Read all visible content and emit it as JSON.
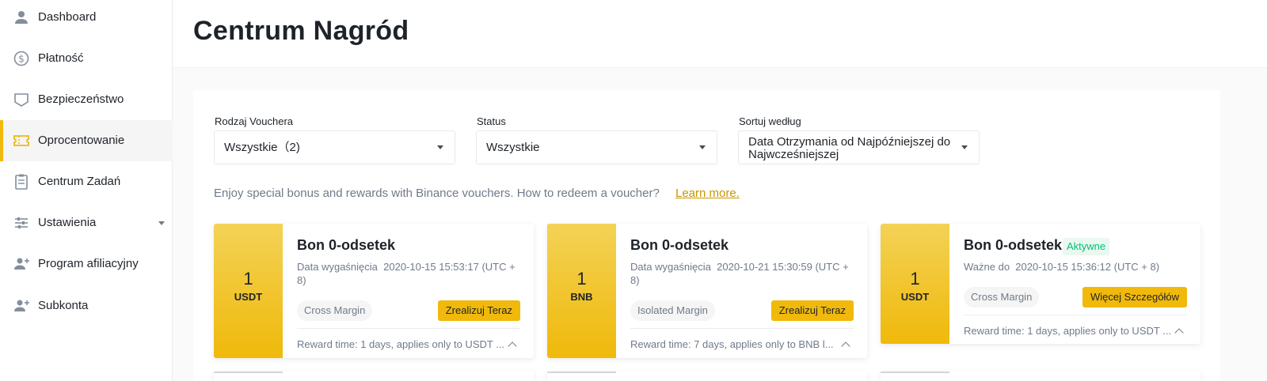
{
  "sidebar": {
    "items": [
      {
        "label": "Dashboard",
        "icon": "user-icon"
      },
      {
        "label": "Płatność",
        "icon": "dollar-circle-icon"
      },
      {
        "label": "Bezpieczeństwo",
        "icon": "shield-icon"
      },
      {
        "label": "Oprocentowanie",
        "icon": "ticket-icon",
        "active": true
      },
      {
        "label": "Centrum Zadań",
        "icon": "clipboard-icon"
      },
      {
        "label": "Ustawienia",
        "icon": "sliders-icon",
        "expandable": true
      },
      {
        "label": "Program afiliacyjny",
        "icon": "add-user-icon"
      },
      {
        "label": "Subkonta",
        "icon": "add-user-icon"
      }
    ]
  },
  "header": {
    "title": "Centrum Nagród"
  },
  "filters": {
    "type": {
      "label": "Rodzaj Vouchera",
      "value": "Wszystkie（2)"
    },
    "status": {
      "label": "Status",
      "value": "Wszystkie"
    },
    "sort": {
      "label": "Sortuj według",
      "value": "Data Otrzymania od Najpóźniejszej do Najwcześniejszej"
    }
  },
  "info": {
    "text": "Enjoy special bonus and rewards with Binance vouchers. How to redeem a voucher?",
    "link": "Learn more."
  },
  "cards": [
    {
      "amount": "1",
      "unit": "USDT",
      "title": "Bon 0-odsetek",
      "badge": "",
      "date_label": "Data wygaśnięcia",
      "date": "2020-10-15 15:53:17 (UTC + 8)",
      "tag": "Cross Margin",
      "button": "Zrealizuj Teraz",
      "reward": "Reward time: 1 days, applies only to USDT ..."
    },
    {
      "amount": "1",
      "unit": "BNB",
      "title": "Bon 0-odsetek",
      "badge": "",
      "date_label": "Data wygaśnięcia",
      "date": "2020-10-21 15:30:59 (UTC + 8)",
      "tag": "Isolated Margin",
      "button": "Zrealizuj Teraz",
      "reward": "Reward time: 7 days, applies only to BNB l..."
    },
    {
      "amount": "1",
      "unit": "USDT",
      "title": "Bon 0-odsetek",
      "badge": "Aktywne",
      "date_label": "Ważne do",
      "date": "2020-10-15 15:36:12 (UTC + 8)",
      "tag": "Cross Margin",
      "button": "Więcej Szczegółów",
      "reward": "Reward time: 1 days, applies only to USDT ..."
    }
  ],
  "colors": {
    "accent": "#f0b90b",
    "link": "#c99400",
    "active_badge": "#02c076"
  }
}
